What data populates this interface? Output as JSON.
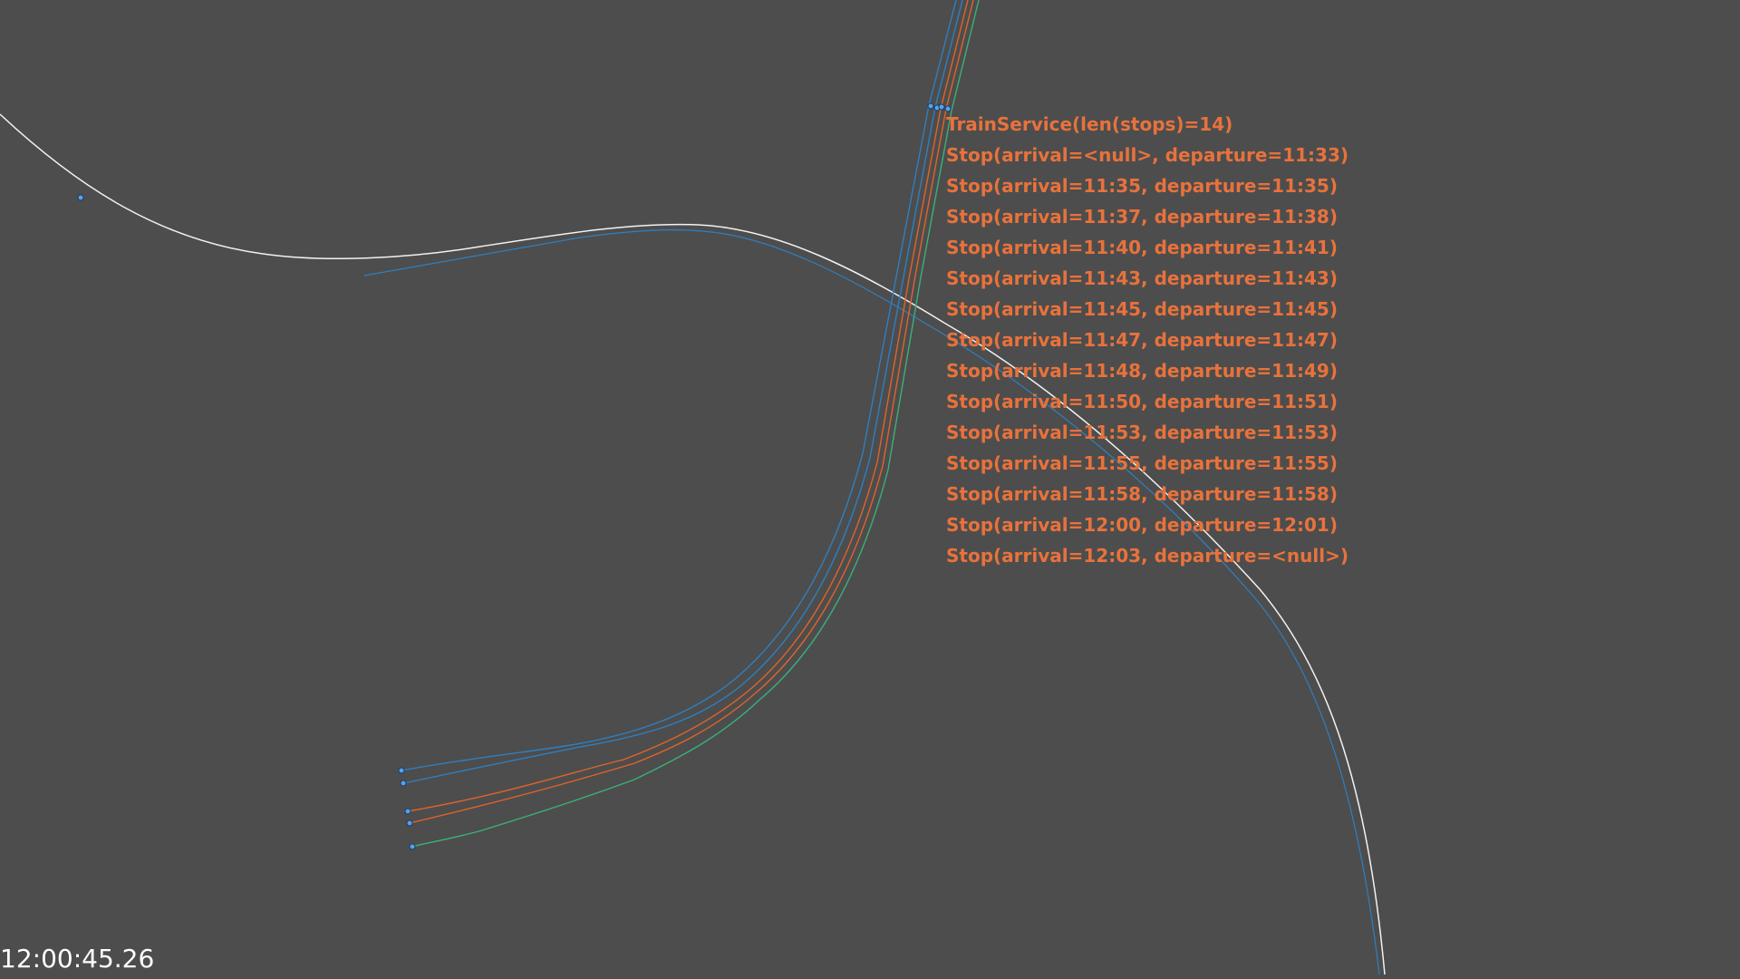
{
  "colors": {
    "background": "#4d4d4d",
    "info_text": "#e8723c",
    "clock_text": "#ffffff",
    "track_white": "#f2f2f2",
    "track_blue": "#2f7fc0",
    "track_orange": "#e0642a",
    "track_green": "#3bb07a",
    "station_marker": "#5aa0e6"
  },
  "service": {
    "header": "TrainService(len(stops)=14)",
    "stops": [
      "Stop(arrival=<null>, departure=11:33)",
      "Stop(arrival=11:35, departure=11:35)",
      "Stop(arrival=11:37, departure=11:38)",
      "Stop(arrival=11:40, departure=11:41)",
      "Stop(arrival=11:43, departure=11:43)",
      "Stop(arrival=11:45, departure=11:45)",
      "Stop(arrival=11:47, departure=11:47)",
      "Stop(arrival=11:48, departure=11:49)",
      "Stop(arrival=11:50, departure=11:51)",
      "Stop(arrival=11:53, departure=11:53)",
      "Stop(arrival=11:55, departure=11:55)",
      "Stop(arrival=11:58, departure=11:58)",
      "Stop(arrival=12:00, departure=12:01)",
      "Stop(arrival=12:03, departure=<null>)"
    ]
  },
  "clock": {
    "time": "12:00:45.26"
  }
}
